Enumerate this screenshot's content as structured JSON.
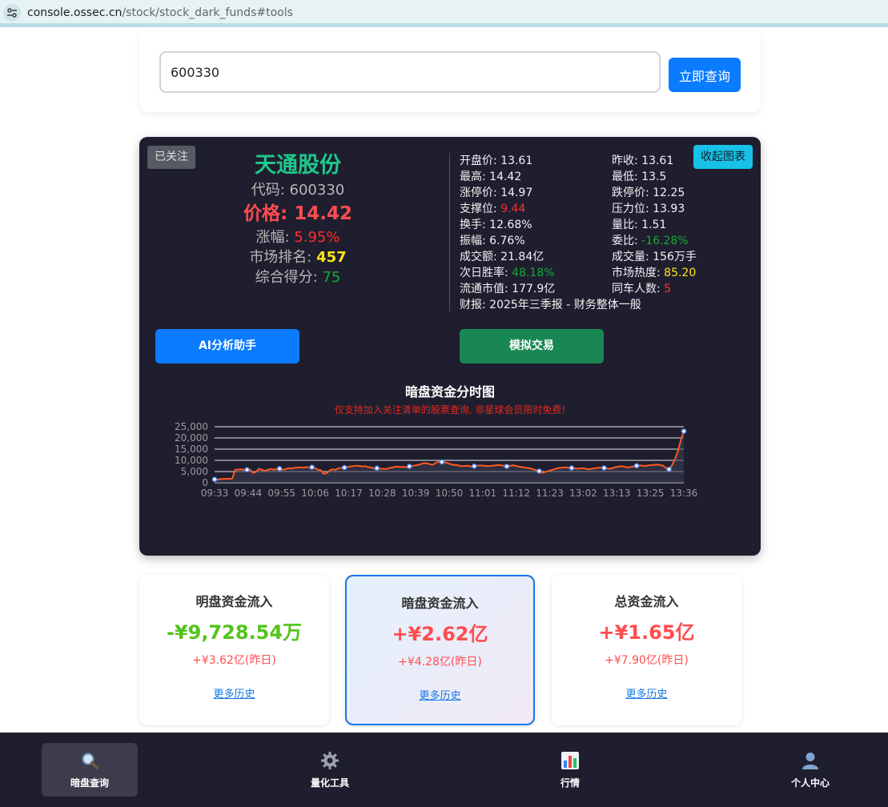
{
  "browser": {
    "url_host": "console.ossec.cn",
    "url_path": "/stock/stock_dark_funds#tools"
  },
  "search": {
    "value": "600330",
    "button_label": "立即查询"
  },
  "stock": {
    "watch_label": "已关注",
    "collapse_label": "收起图表",
    "name": "天通股份",
    "code_label": "代码: ",
    "code": "600330",
    "price_label": "价格: ",
    "price": "14.42",
    "change_label": "涨幅: ",
    "change": "5.95%",
    "rank_label": "市场排名: ",
    "rank": "457",
    "score_label": "综合得分: ",
    "score": "75",
    "metrics": {
      "open": {
        "label": "开盘价: ",
        "value": "13.61"
      },
      "prev_close": {
        "label": "昨收: ",
        "value": "13.61"
      },
      "high": {
        "label": "最高: ",
        "value": "14.42"
      },
      "low": {
        "label": "最低: ",
        "value": "13.5"
      },
      "limit_up": {
        "label": "涨停价: ",
        "value": "14.97"
      },
      "limit_down": {
        "label": "跌停价: ",
        "value": "12.25"
      },
      "support": {
        "label": "支撑位: ",
        "value": "9.44"
      },
      "resistance": {
        "label": "压力位: ",
        "value": "13.93"
      },
      "turnover": {
        "label": "换手: ",
        "value": "12.68%"
      },
      "volume_ratio": {
        "label": "量比: ",
        "value": "1.51"
      },
      "amplitude": {
        "label": "振幅: ",
        "value": "6.76%"
      },
      "order_ratio": {
        "label": "委比: ",
        "value": "-16.28%"
      },
      "amount": {
        "label": "成交额: ",
        "value": "21.84亿"
      },
      "volume": {
        "label": "成交量: ",
        "value": "156万手"
      },
      "next_win": {
        "label": "次日胜率: ",
        "value": "48.18%"
      },
      "heat": {
        "label": "市场热度: ",
        "value": "85.20"
      },
      "float_cap": {
        "label": "流通市值: ",
        "value": "177.9亿"
      },
      "peers": {
        "label": "同车人数: ",
        "value": "5"
      },
      "report": {
        "label": "财报: ",
        "value": "2025年三季报 - 财务整体一般"
      }
    },
    "ai_button": "AI分析助手",
    "sim_button": "模拟交易"
  },
  "chart_data": {
    "type": "line",
    "title": "暗盘资金分时图",
    "subtitle": "仅支持加入关注清单的股票查询, 非星球会员限时免费!",
    "ylim": [
      0,
      25000
    ],
    "y_ticks": [
      "25,000",
      "20,000",
      "15,000",
      "10,000",
      "5,000",
      "0"
    ],
    "y_tick_values": [
      25000,
      20000,
      15000,
      10000,
      5000,
      0
    ],
    "x_ticks": [
      "09:33",
      "09:44",
      "09:55",
      "10:06",
      "10:17",
      "10:28",
      "10:39",
      "10:50",
      "11:01",
      "11:12",
      "11:23",
      "13:02",
      "13:13",
      "13:25",
      "13:36"
    ],
    "grid": true,
    "line_color": "#ff5a1f",
    "fill_color": "#3a3a52",
    "marker_color": "#5b8ff9",
    "series": [
      {
        "values": [
          1500,
          1400,
          1600,
          1700,
          1800,
          1700,
          1900,
          5800,
          5900,
          6000,
          5700,
          5800,
          5900,
          4500,
          4800,
          6200,
          5800,
          5300,
          5800,
          6100,
          5900,
          6000,
          6300,
          5800,
          6000,
          6500,
          6300,
          6700,
          6800,
          6900,
          6700,
          7000,
          6800,
          6900,
          6600,
          5800,
          5600,
          4000,
          4300,
          5500,
          6000,
          5800,
          6500,
          6600,
          6800,
          7000,
          7200,
          7400,
          7600,
          7500,
          7300,
          7400,
          7000,
          6800,
          6400,
          6500,
          6300,
          6200,
          6100,
          6500,
          6800,
          7000,
          7200,
          7000,
          7100,
          6900,
          7300,
          7400,
          7800,
          8000,
          8400,
          8800,
          8600,
          8300,
          8000,
          8900,
          9400,
          9300,
          9100,
          8800,
          8300,
          8000,
          7900,
          7600,
          7400,
          7500,
          7600,
          7200,
          7400,
          7600,
          7800,
          7600,
          7500,
          7400,
          7600,
          7700,
          7900,
          7800,
          7600,
          7300,
          7500,
          7800,
          7600,
          7200,
          7000,
          6800,
          6600,
          6400,
          6000,
          5600,
          5200,
          4500,
          4800,
          5200,
          5600,
          6000,
          6400,
          6600,
          6800,
          6900,
          6700,
          6600,
          6400,
          6300,
          6400,
          6500,
          6200,
          6000,
          6300,
          6500,
          6700,
          6800,
          6600,
          6400,
          6200,
          6600,
          7000,
          7200,
          7400,
          7100,
          6900,
          7000,
          7300,
          7600,
          7800,
          7600,
          7500,
          7700,
          7900,
          8000,
          8100,
          7900,
          7600,
          6500,
          6000,
          7800,
          10500,
          14000,
          19000,
          23000
        ]
      }
    ],
    "marker_every": 11
  },
  "flows": [
    {
      "title": "明盘资金流入",
      "value": "-¥9,728.54万",
      "prev": "+¥3.62亿(昨日)",
      "link": "更多历史"
    },
    {
      "title": "暗盘资金流入",
      "value": "+¥2.62亿",
      "prev": "+¥4.28亿(昨日)",
      "link": "更多历史"
    },
    {
      "title": "总资金流入",
      "value": "+¥1.65亿",
      "prev": "+¥7.90亿(昨日)",
      "link": "更多历史"
    }
  ],
  "nav": [
    {
      "label": "暗盘查询",
      "icon": "magnifier-icon"
    },
    {
      "label": "量化工具",
      "icon": "gear-icon"
    },
    {
      "label": "行情",
      "icon": "bar-chart-icon"
    },
    {
      "label": "个人中心",
      "icon": "person-icon"
    }
  ]
}
